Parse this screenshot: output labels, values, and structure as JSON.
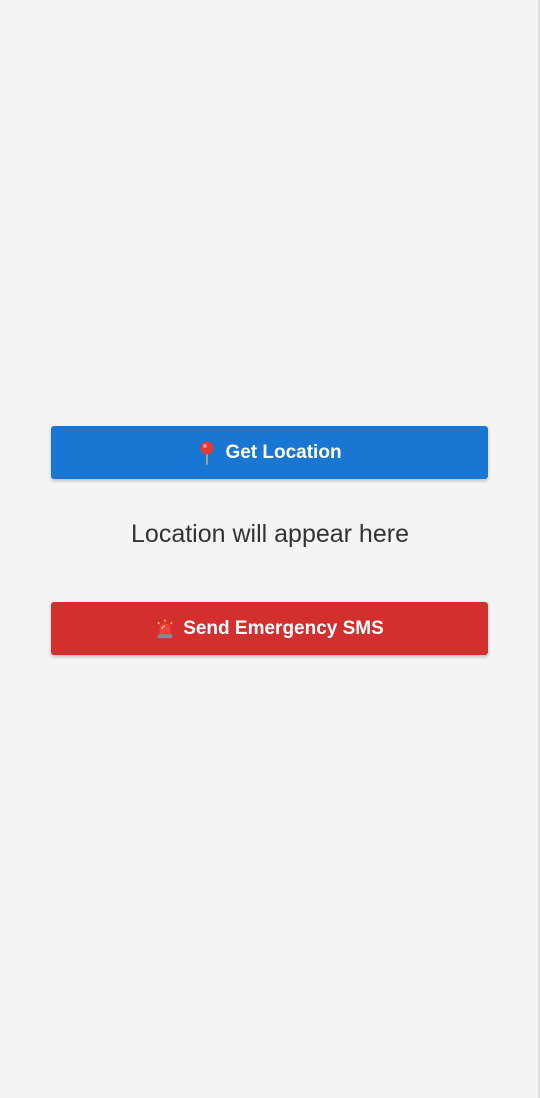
{
  "screen": {
    "background_color": "#f4f4f4"
  },
  "get_location_button": {
    "label": "Get Location",
    "icon": "round-pushpin-icon",
    "color": "#1976d2"
  },
  "location_display": {
    "text": "Location will appear here"
  },
  "emergency_sms_button": {
    "label": "Send Emergency SMS",
    "icon": "police-siren-icon",
    "color": "#d32f2f"
  }
}
